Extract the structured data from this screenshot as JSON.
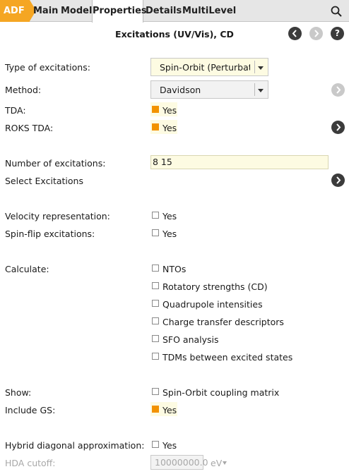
{
  "tabs": {
    "brand": "ADF",
    "items": [
      "Main",
      "Model",
      "Properties",
      "Details",
      "MultiLevel"
    ],
    "active": "Properties"
  },
  "icons": {
    "search": "search-icon",
    "back": "chevron-left-icon",
    "forward": "chevron-right-icon",
    "help": "help-icon",
    "expand": "chevron-right-icon"
  },
  "colors": {
    "accent": "#f5a623",
    "checked": "#f29200",
    "field_bg": "#fdfbe2",
    "icon_dark": "#3b3b3b",
    "icon_disabled": "#c9c9c9"
  },
  "panel": {
    "title": "Excitations (UV/Vis), CD",
    "help": "?"
  },
  "form": {
    "type_of_excitations": {
      "label": "Type of excitations:",
      "value": "Spin-Orbit (Perturbative)"
    },
    "method": {
      "label": "Method:",
      "value": "Davidson"
    },
    "tda": {
      "label": "TDA:",
      "text": "Yes",
      "checked": true
    },
    "roks_tda": {
      "label": "ROKS TDA:",
      "text": "Yes",
      "checked": true
    },
    "number_of_excitations": {
      "label": "Number of excitations:",
      "value": "8 15"
    },
    "select_excitations": {
      "label": "Select Excitations"
    },
    "velocity_representation": {
      "label": "Velocity representation:",
      "text": "Yes",
      "checked": false
    },
    "spin_flip": {
      "label": "Spin-flip excitations:",
      "text": "Yes",
      "checked": false
    },
    "calculate": {
      "label": "Calculate:",
      "options": [
        {
          "text": "NTOs",
          "checked": false
        },
        {
          "text": "Rotatory strengths (CD)",
          "checked": false
        },
        {
          "text": "Quadrupole intensities",
          "checked": false
        },
        {
          "text": "Charge transfer descriptors",
          "checked": false
        },
        {
          "text": "SFO analysis",
          "checked": false
        },
        {
          "text": "TDMs between excited states",
          "checked": false
        }
      ]
    },
    "show": {
      "label": "Show:",
      "text": "Spin-Orbit coupling matrix",
      "checked": false
    },
    "include_gs": {
      "label": "Include GS:",
      "text": "Yes",
      "checked": true
    },
    "hybrid_diag": {
      "label": "Hybrid diagonal approximation:",
      "text": "Yes",
      "checked": false
    },
    "hda_cutoff": {
      "label": "HDA cutoff:",
      "value": "10000000.0",
      "unit": "eV"
    }
  }
}
